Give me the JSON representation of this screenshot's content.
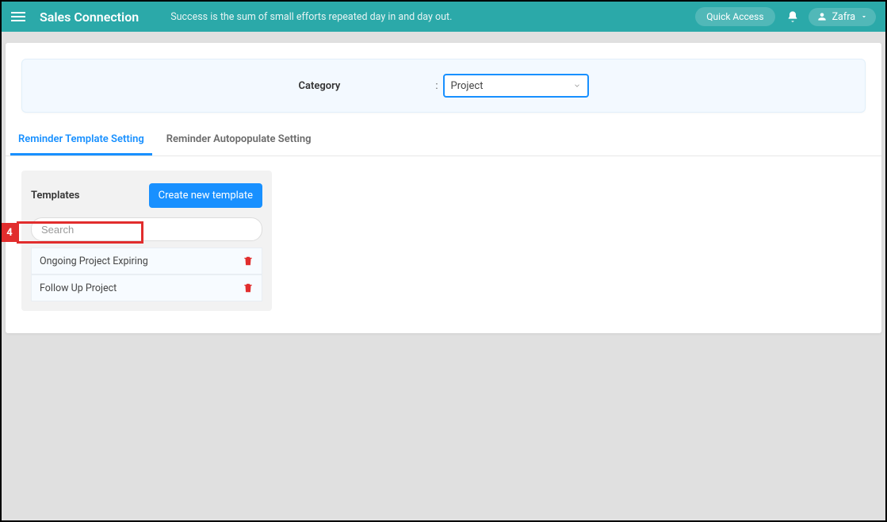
{
  "header": {
    "brand": "Sales Connection",
    "tagline": "Success is the sum of small efforts repeated day in and day out.",
    "quick_access": "Quick Access",
    "user_name": "Zafra"
  },
  "category": {
    "label": "Category",
    "value": "Project"
  },
  "tabs": [
    {
      "label": "Reminder Template Setting",
      "active": true
    },
    {
      "label": "Reminder Autopopulate Setting",
      "active": false
    }
  ],
  "templates": {
    "title": "Templates",
    "create_label": "Create new template",
    "search_placeholder": "Search",
    "items": [
      {
        "name": "Ongoing Project Expiring"
      },
      {
        "name": "Follow Up Project"
      }
    ]
  },
  "annotation": {
    "number": "4"
  }
}
